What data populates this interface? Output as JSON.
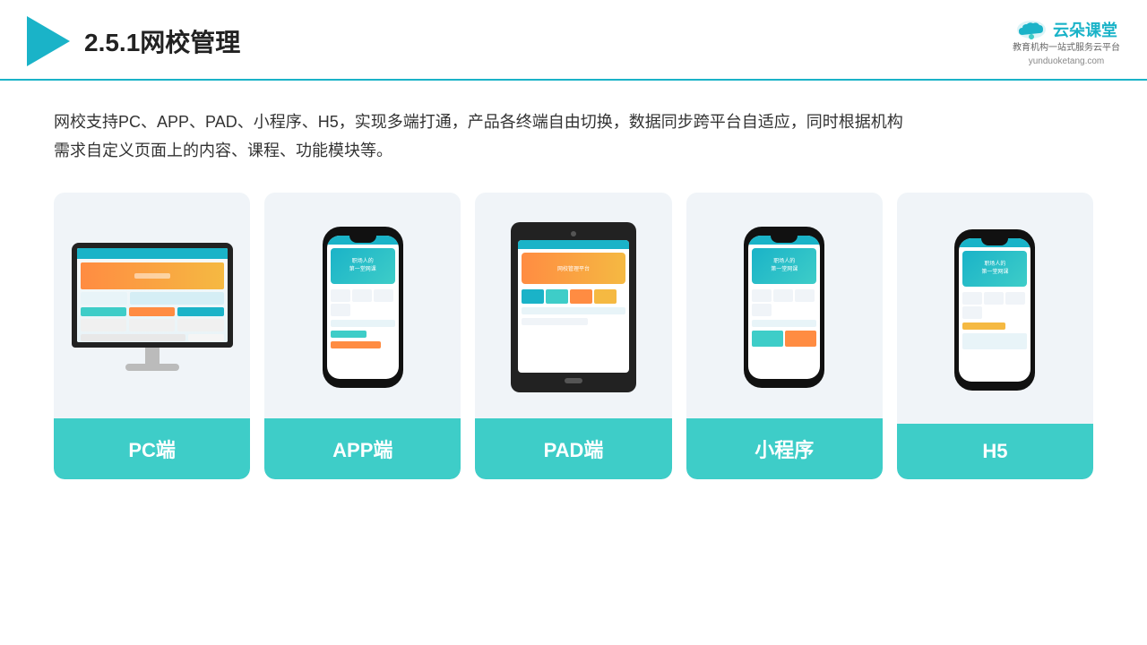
{
  "header": {
    "title": "2.5.1网校管理",
    "brand": {
      "name": "云朵课堂",
      "tagline": "教育机构一站\n式服务云平台",
      "url": "yunduoketang.com"
    }
  },
  "description": "网校支持PC、APP、PAD、小程序、H5，实现多端打通，产品各终端自由切换，数据同步跨平台自适应，同时根据机构\n需求自定义页面上的内容、课程、功能模块等。",
  "cards": [
    {
      "id": "pc",
      "label": "PC端",
      "type": "pc"
    },
    {
      "id": "app",
      "label": "APP端",
      "type": "phone"
    },
    {
      "id": "pad",
      "label": "PAD端",
      "type": "tablet"
    },
    {
      "id": "miniprogram",
      "label": "小程序",
      "type": "phone"
    },
    {
      "id": "h5",
      "label": "H5",
      "type": "phone"
    }
  ]
}
